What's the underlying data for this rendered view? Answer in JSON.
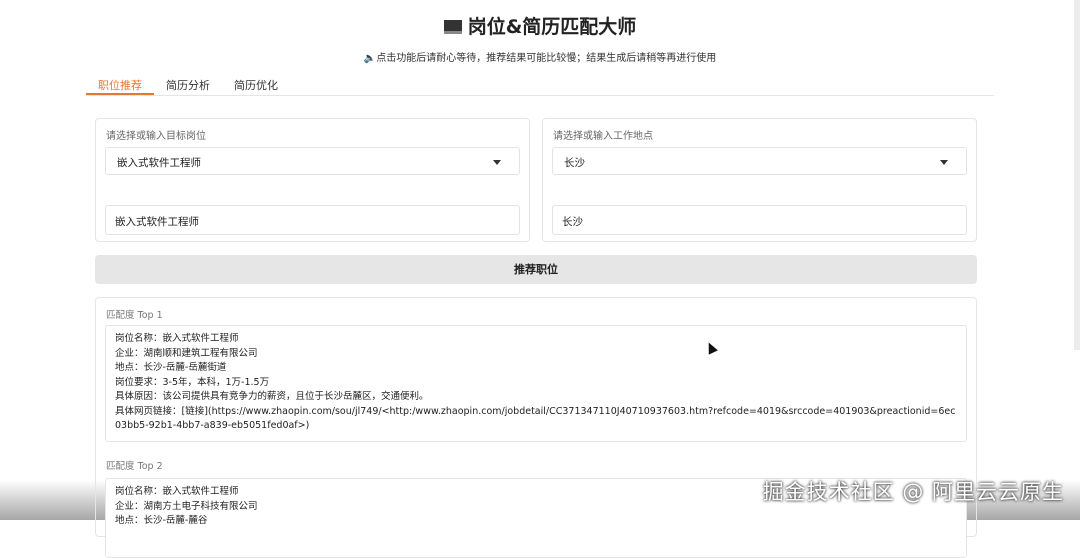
{
  "header": {
    "title": "岗位&简历匹配大师",
    "subtitle": "🔈点击功能后请耐心等待，推荐结果可能比较慢；结果生成后请稍等再进行使用"
  },
  "tabs": [
    {
      "label": "职位推荐"
    },
    {
      "label": "简历分析"
    },
    {
      "label": "简历优化"
    }
  ],
  "job": {
    "label": "请选择或输入目标岗位",
    "selected": "嵌入式软件工程师",
    "input": "嵌入式软件工程师"
  },
  "location": {
    "label": "请选择或输入工作地点",
    "selected": "长沙",
    "input": "长沙"
  },
  "recommend_button": "推荐职位",
  "results": [
    {
      "label": "匹配度 Top 1",
      "lines": [
        "岗位名称：嵌入式软件工程师",
        "企业：湖南顺和建筑工程有限公司",
        "地点：长沙-岳麓-岳麓街道",
        "岗位要求：3-5年，本科，1万-1.5万",
        "具体原因：该公司提供具有竞争力的薪资，且位于长沙岳麓区，交通便利。",
        "具体网页链接：[链接](https://www.zhaopin.com/sou/jl749/<http:/www.zhaopin.com/jobdetail/CC371347110J40710937603.htm?refcode=4019&srccode=401903&preactionid=6ec03bb5-92b1-4bb7-a839-eb5051fed0af>)"
      ]
    },
    {
      "label": "匹配度 Top 2",
      "lines": [
        "岗位名称：嵌入式软件工程师",
        "企业：湖南方土电子科技有限公司",
        "地点：长沙-岳麓-麓谷"
      ]
    }
  ],
  "watermark": "掘金技术社区 @ 阿里云云原生"
}
